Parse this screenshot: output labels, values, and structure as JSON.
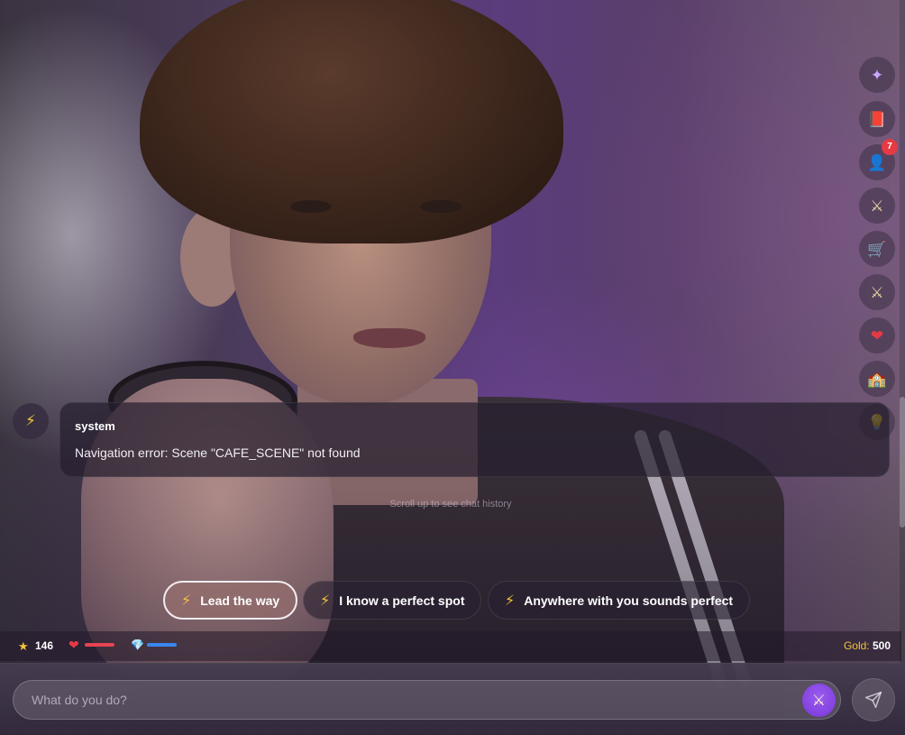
{
  "rail": {
    "items": [
      {
        "name": "sparkle-icon",
        "glyph": "✦"
      },
      {
        "name": "book-icon",
        "glyph": "📕"
      },
      {
        "name": "profile-icon",
        "glyph": "👤",
        "badge": "7"
      },
      {
        "name": "crossed-swords-icon",
        "glyph": "⚔"
      },
      {
        "name": "shopping-cart-icon",
        "glyph": "🛒"
      },
      {
        "name": "battle-icon",
        "glyph": "⚔"
      },
      {
        "name": "heart-icon",
        "glyph": "❤"
      },
      {
        "name": "building-icon",
        "glyph": "🏫"
      },
      {
        "name": "lightbulb-icon",
        "glyph": "💡"
      }
    ]
  },
  "message": {
    "avatar_glyph": "⚡",
    "sender": "system",
    "text": "Navigation error: Scene \"CAFE_SCENE\" not found"
  },
  "hint": "Scroll up to see chat history",
  "suggestions": {
    "bolt": "⚡",
    "items": [
      {
        "label": "Lead the way",
        "selected": true
      },
      {
        "label": "I know a perfect spot",
        "selected": false
      },
      {
        "label": "Anywhere with you sounds perfect",
        "selected": false
      }
    ]
  },
  "stats": {
    "star_glyph": "★",
    "xp": "146",
    "heart_glyph": "❤",
    "hp_fraction": 1.0,
    "gem_glyph": "💎",
    "mp_fraction": 1.0,
    "gold_label": "Gold:",
    "gold_value": "500"
  },
  "input": {
    "placeholder": "What do you do?",
    "value": "",
    "action_glyph": "⚔"
  },
  "colors": {
    "accent_purple": "#8a48e6",
    "bolt_yellow": "#f5c43c",
    "hp_red": "#e54452",
    "mp_blue": "#3c86f0",
    "badge_red": "#e53a44"
  }
}
